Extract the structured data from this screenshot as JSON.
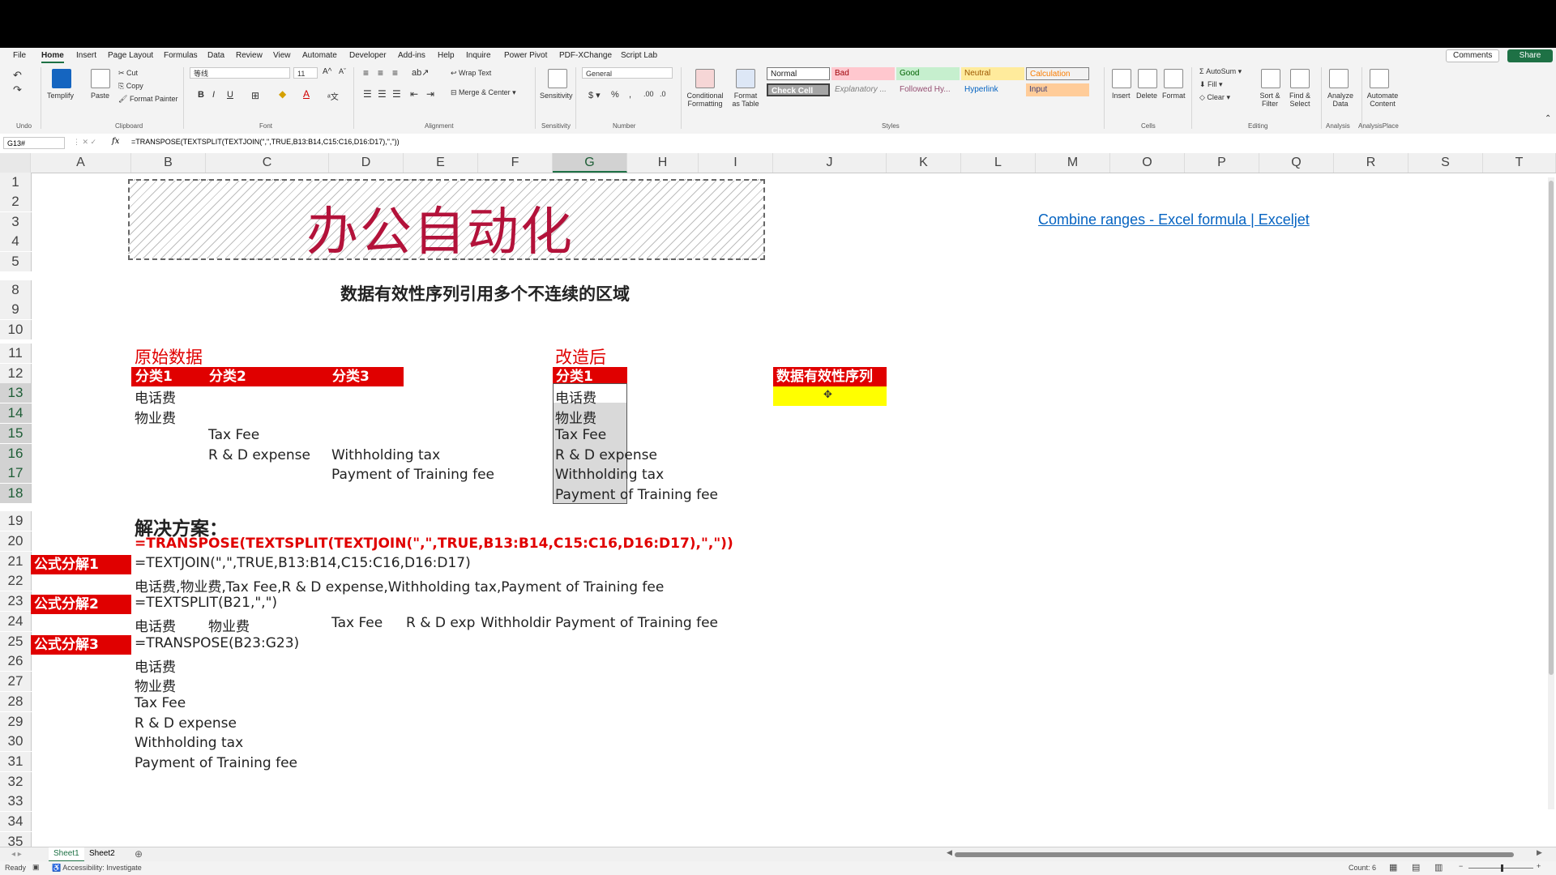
{
  "menu": {
    "tabs": [
      "File",
      "Home",
      "Insert",
      "Page Layout",
      "Formulas",
      "Data",
      "Review",
      "View",
      "Automate",
      "Developer",
      "Add-ins",
      "Help",
      "Inquire",
      "Power Pivot",
      "PDF-XChange",
      "Script Lab"
    ],
    "active": "Home",
    "comments": "Comments",
    "share": "Share"
  },
  "ribbon": {
    "undo_label": "Undo",
    "templify": "Templify",
    "paste": "Paste",
    "cut": "Cut",
    "copy": "Copy",
    "format_painter": "Format Painter",
    "clipboard_label": "Clipboard",
    "font_name": "等线",
    "font_size": "11",
    "font_label": "Font",
    "wrap_text": "Wrap Text",
    "merge_center": "Merge & Center",
    "alignment_label": "Alignment",
    "sensitivity": "Sensitivity",
    "sensitivity_label": "Sensitivity",
    "number_format": "General",
    "number_label": "Number",
    "conditional_formatting": "Conditional Formatting",
    "format_as_table": "Format as Table",
    "styles": {
      "normal": "Normal",
      "bad": "Bad",
      "good": "Good",
      "neutral": "Neutral",
      "calculation": "Calculation",
      "check_cell": "Check Cell",
      "explanatory": "Explanatory ...",
      "followed": "Followed Hy...",
      "hyperlink": "Hyperlink",
      "input": "Input"
    },
    "styles_label": "Styles",
    "insert": "Insert",
    "delete": "Delete",
    "format": "Format",
    "cells_label": "Cells",
    "autosum": "AutoSum",
    "fill": "Fill",
    "clear": "Clear",
    "sort_filter": "Sort & Filter",
    "find_select": "Find & Select",
    "editing_label": "Editing",
    "analyze_data": "Analyze Data",
    "analysis_label": "Analysis",
    "automate_content": "Automate Content",
    "analysisplace_label": "AnalysisPlace"
  },
  "formula_bar": {
    "name_box": "G13#",
    "fx": "fx",
    "formula": "=TRANSPOSE(TEXTSPLIT(TEXTJOIN(\",\",TRUE,B13:B14,C15:C16,D16:D17),\",\"))"
  },
  "columns": [
    "A",
    "B",
    "C",
    "D",
    "E",
    "F",
    "G",
    "H",
    "I",
    "J",
    "K",
    "L",
    "M",
    "O",
    "P",
    "Q",
    "R",
    "S",
    "T"
  ],
  "selected_column": "G",
  "rows": [
    "1",
    "2",
    "3",
    "4",
    "5",
    "8",
    "9",
    "10",
    "11",
    "12",
    "13",
    "14",
    "15",
    "16",
    "17",
    "18",
    "19",
    "20",
    "21",
    "22",
    "23",
    "24",
    "25",
    "26",
    "27",
    "28",
    "29",
    "30",
    "31",
    "32",
    "33",
    "34",
    "35"
  ],
  "selected_rows": [
    "13",
    "14",
    "15",
    "16",
    "17",
    "18"
  ],
  "sheet": {
    "banner_title": "办公自动化",
    "link": "Combine ranges - Excel formula | Exceljet",
    "subtitle": "数据有效性序列引用多个不连续的区域",
    "orig_label": "原始数据",
    "after_label": "改造后",
    "hdr_cat1": "分类1",
    "hdr_cat2": "分类2",
    "hdr_cat3": "分类3",
    "hdr_after": "分类1",
    "dv_header": "数据有效性序列",
    "b13": "电话费",
    "b14": "物业费",
    "c15": "Tax Fee",
    "c16": "R & D expense",
    "d16": "Withholding tax",
    "d17": "Payment of Training fee",
    "result": [
      "电话费",
      "物业费",
      "Tax Fee",
      "R & D expense",
      "Withholding tax",
      "Payment of Training fee"
    ],
    "solution": "解决方案：",
    "main_formula": "=TRANSPOSE(TEXTSPLIT(TEXTJOIN(\",\",TRUE,B13:B14,C15:C16,D16:D17),\",\"))",
    "step1_label": "公式分解1",
    "step1_formula": "=TEXTJOIN(\",\",TRUE,B13:B14,C15:C16,D16:D17)",
    "step1_result": "电话费,物业费,Tax Fee,R & D expense,Withholding tax,Payment of Training fee",
    "step2_label": "公式分解2",
    "step2_formula": "=TEXTSPLIT(B21,\",\")",
    "step2_result": [
      "电话费",
      "物业费",
      "",
      "Tax Fee",
      "R & D exp",
      "Withholdir",
      "Payment of Training fee"
    ],
    "step3_label": "公式分解3",
    "step3_formula": "=TRANSPOSE(B23:G23)",
    "step3_result": [
      "电话费",
      "物业费",
      "Tax Fee",
      "R & D expense",
      "Withholding tax",
      "Payment of Training fee"
    ]
  },
  "sheets": [
    "Sheet1",
    "Sheet2"
  ],
  "active_sheet": "Sheet1",
  "status": {
    "ready": "Ready",
    "accessibility": "Accessibility: Investigate",
    "count": "Count: 6"
  },
  "colors": {
    "accent_green": "#1e7145",
    "header_red": "#e00000",
    "title_red": "#b3123a",
    "highlight_yellow": "#ffff00"
  }
}
